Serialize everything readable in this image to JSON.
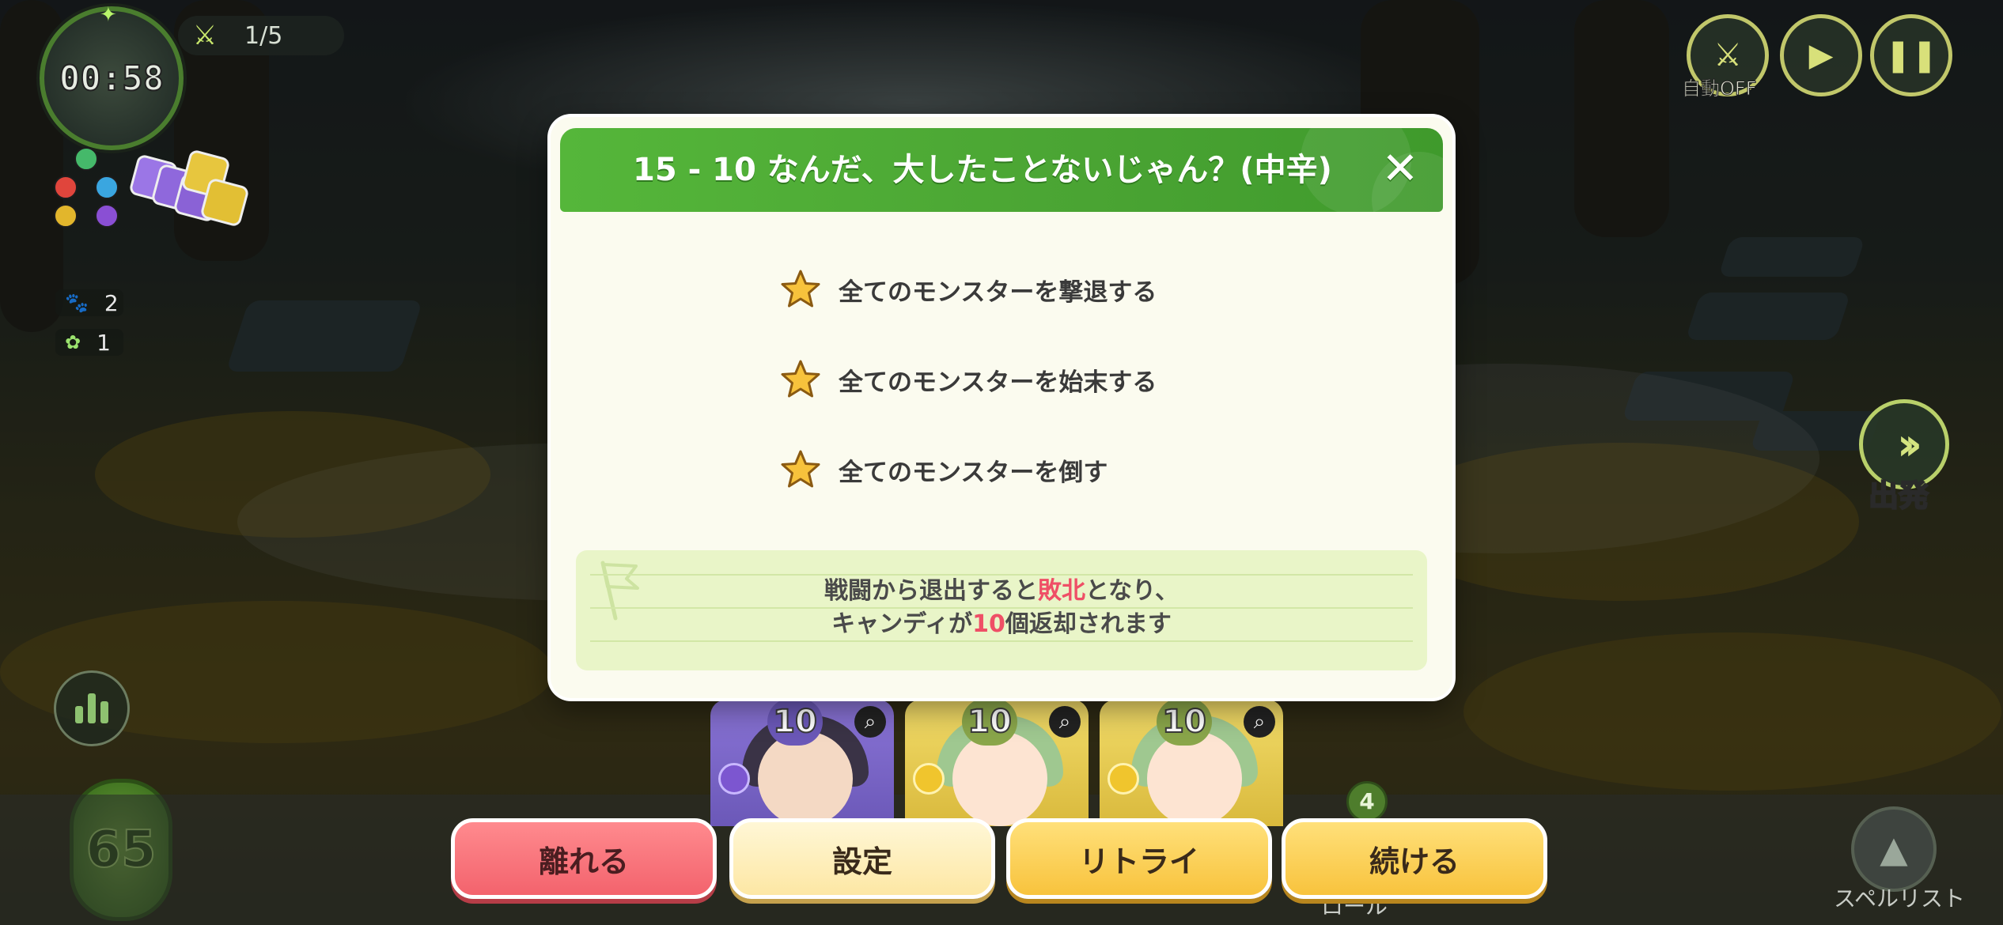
{
  "hud": {
    "timer": "00:58",
    "wave": "1/5",
    "paw_count": "2",
    "sprout_count": "1",
    "candy_count": "65",
    "auto_label": "自動OFF",
    "depart_label": "出発",
    "spell_list_label": "スペルリスト",
    "partial_label": "ロール"
  },
  "cards": [
    {
      "level": "10",
      "element": "purple"
    },
    {
      "level": "10",
      "element": "yellow"
    },
    {
      "level": "10",
      "element": "yellow"
    }
  ],
  "slot_badge": "4",
  "modal": {
    "title": "15 - 10 なんだ、大したことないじゃん？(中辛)",
    "close_symbol": "✕",
    "missions": [
      "全てのモンスターを撃退する",
      "全てのモンスターを始末する",
      "全てのモンスターを倒す"
    ],
    "notice": {
      "line1_before": "戦闘から退出すると",
      "line1_red": "敗北",
      "line1_after": "となり、",
      "line2_before": "キャンディが",
      "line2_red": "10",
      "line2_after": "個返却されます"
    }
  },
  "buttons": {
    "leave": "離れる",
    "settings": "設定",
    "retry": "リトライ",
    "continue": "続ける"
  },
  "colors": {
    "header_green": "#4aa433",
    "leave_red": "#f3636d",
    "retry_yellow": "#f8c33d",
    "accent_red_text": "#ef4f66"
  }
}
